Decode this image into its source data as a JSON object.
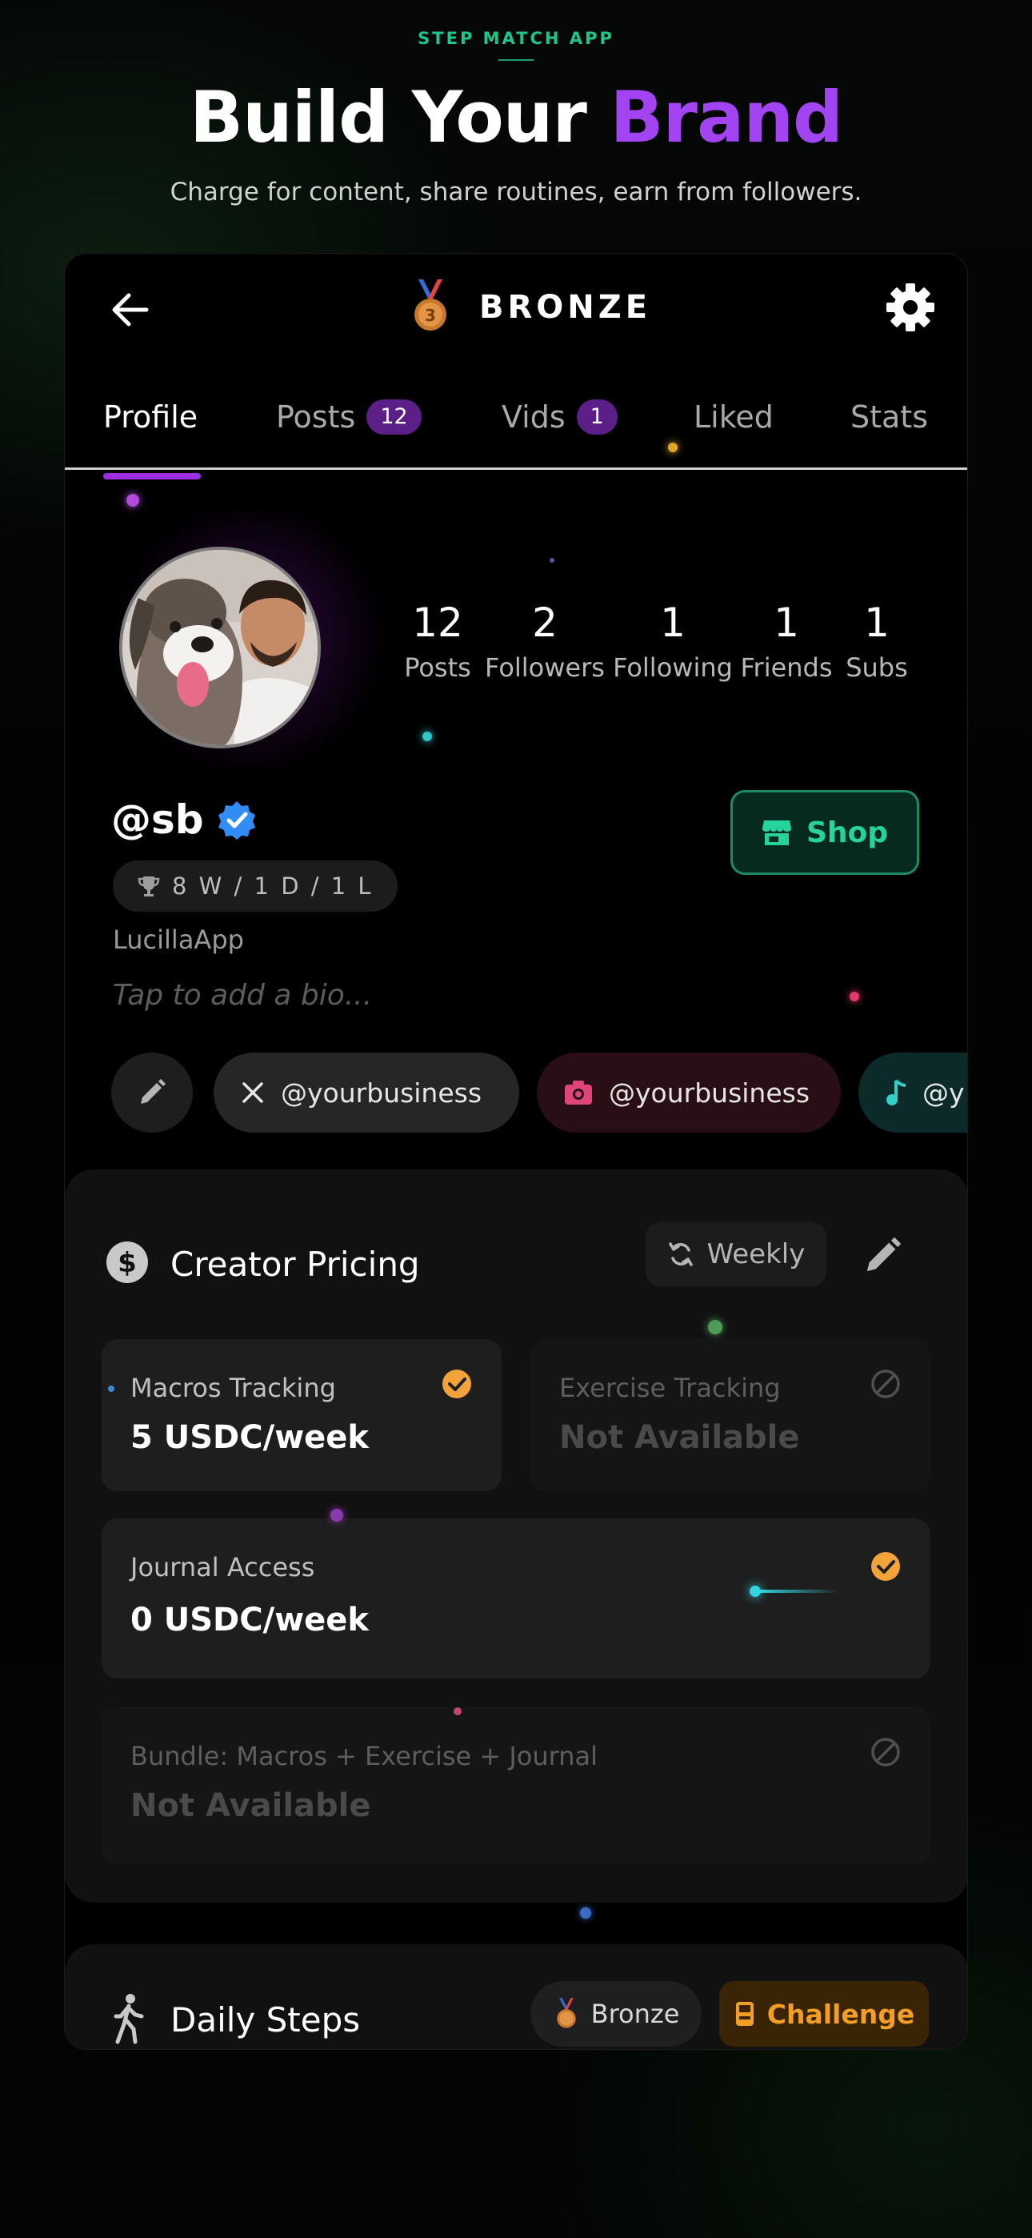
{
  "header": {
    "eyebrow": "STEP MATCH APP",
    "title_main": "Build Your",
    "title_accent": "Brand",
    "subtitle": "Charge for content, share routines, earn from followers."
  },
  "topbar": {
    "rank": "BRONZE",
    "medal_number": "3"
  },
  "tabs": [
    {
      "label": "Profile",
      "active": true
    },
    {
      "label": "Posts",
      "count": "12"
    },
    {
      "label": "Vids",
      "count": "1"
    },
    {
      "label": "Liked"
    },
    {
      "label": "Stats"
    }
  ],
  "stats": [
    {
      "value": "12",
      "label": "Posts"
    },
    {
      "value": "2",
      "label": "Followers"
    },
    {
      "value": "1",
      "label": "Following"
    },
    {
      "value": "1",
      "label": "Friends"
    },
    {
      "value": "1",
      "label": "Subs"
    }
  ],
  "profile": {
    "handle": "@sb",
    "record": "8 W / 1 D / 1 L",
    "org": "LucillaApp",
    "bio_placeholder": "Tap to add a bio...",
    "shop_label": "Shop"
  },
  "socials": [
    {
      "platform": "x",
      "handle": "@yourbusiness"
    },
    {
      "platform": "instagram",
      "handle": "@yourbusiness"
    },
    {
      "platform": "tiktok",
      "handle": "@y"
    }
  ],
  "pricing": {
    "title": "Creator Pricing",
    "period": "Weekly",
    "tiles": [
      {
        "label": "Macros Tracking",
        "value": "5 USDC/week",
        "available": true
      },
      {
        "label": "Exercise Tracking",
        "value": "Not Available",
        "available": false
      },
      {
        "label": "Journal Access",
        "value": "0 USDC/week",
        "available": true
      },
      {
        "label": "Bundle: Macros + Exercise + Journal",
        "value": "Not Available",
        "available": false
      }
    ]
  },
  "steps": {
    "title": "Daily Steps",
    "tier": "Bronze",
    "challenge": "Challenge"
  },
  "colors": {
    "accent_purple": "#a344f2",
    "accent_green": "#1fc58e",
    "warning_orange": "#f29e24",
    "verified_blue": "#2f8df5"
  }
}
